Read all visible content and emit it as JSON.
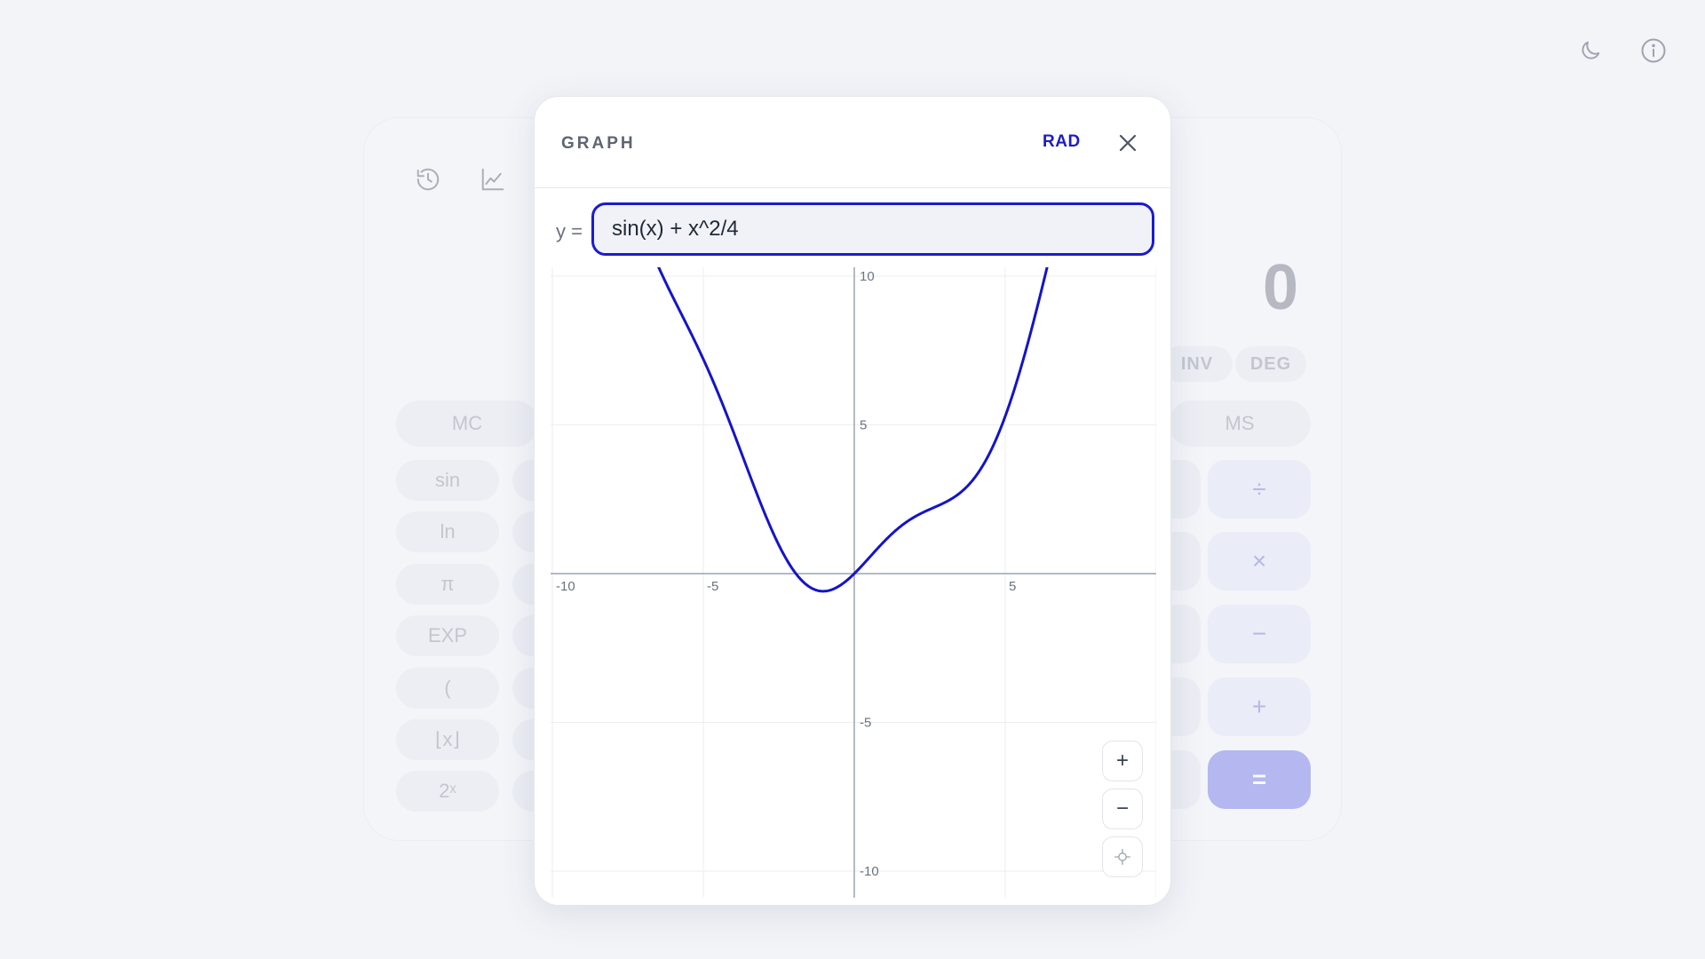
{
  "topbar": {
    "theme_icon": "moon-icon",
    "info_icon": "info-icon"
  },
  "calculator": {
    "display_value": "0",
    "mode_buttons": [
      "INV",
      "DEG"
    ],
    "memory_buttons": [
      "MC",
      "MS"
    ],
    "function_buttons": [
      "sin",
      "ln",
      "π",
      "EXP",
      "(",
      "⌊x⌋",
      "2ˣ"
    ],
    "operator_buttons": [
      "÷",
      "×",
      "−",
      "+",
      "="
    ],
    "tool_icons": [
      "history-icon",
      "graph-icon"
    ]
  },
  "graph_dialog": {
    "title": "GRAPH",
    "angle_mode": "RAD",
    "y_label": "y =",
    "expression": "sin(x) + x^2/4",
    "zoom_in": "+",
    "zoom_out": "−",
    "curve_color": "#1414c8",
    "input_border_color": "#1b1bd0"
  },
  "chart_data": {
    "type": "line",
    "series": [
      {
        "expression": "sin(x) + x^2/4"
      }
    ],
    "xlim": [
      -10,
      10
    ],
    "ylim": [
      -10,
      10
    ],
    "x_ticks": [
      "-10",
      "-5",
      "5"
    ],
    "y_ticks": [
      "10",
      "5",
      "-5",
      "-10"
    ],
    "grid": true
  }
}
